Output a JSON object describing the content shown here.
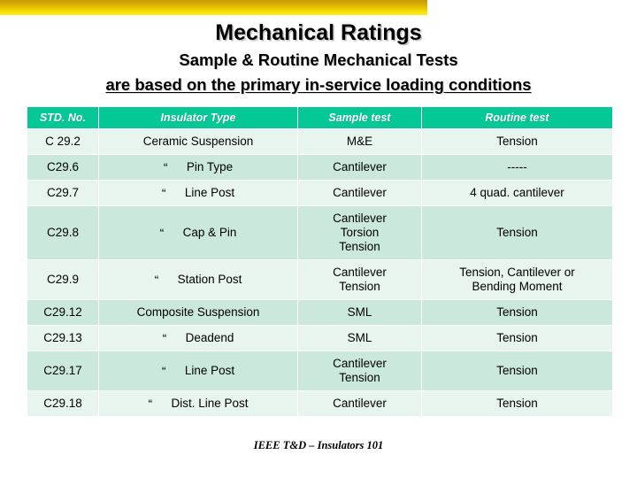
{
  "decor": {
    "gold_bar_color_top": "#c79a06",
    "gold_bar_color_bottom": "#f9ef10"
  },
  "heading": {
    "title": "Mechanical Ratings",
    "subtitle_line1": "Sample & Routine Mechanical Tests",
    "subtitle_line2": "are based on the primary in-service loading conditions"
  },
  "table": {
    "header_bg": "#06c896",
    "row_bg_light": "#e8f4ee",
    "row_bg_dark": "#cbe8dc",
    "columns": [
      "STD. No.",
      "Insulator Type",
      "Sample test",
      "Routine test"
    ],
    "ditto_mark": "“",
    "rows": [
      {
        "std": "C 29.2",
        "ditto": "",
        "type": "Ceramic Suspension",
        "sample": "M&E",
        "routine": "Tension"
      },
      {
        "std": "C29.6",
        "ditto": "“",
        "type": "Pin Type",
        "sample": "Cantilever",
        "routine": "-----"
      },
      {
        "std": "C29.7",
        "ditto": "“",
        "type": "Line Post",
        "sample": "Cantilever",
        "routine": "4 quad. cantilever"
      },
      {
        "std": "C29.8",
        "ditto": "“",
        "type": "Cap & Pin",
        "sample": "Cantilever\nTorsion\nTension",
        "routine": "Tension"
      },
      {
        "std": "C29.9",
        "ditto": "“",
        "type": "Station Post",
        "sample": "Cantilever\nTension",
        "routine": "Tension, Cantilever or\nBending Moment"
      },
      {
        "std": "C29.12",
        "ditto": "",
        "type": "Composite Suspension",
        "sample": "SML",
        "routine": "Tension"
      },
      {
        "std": "C29.13",
        "ditto": "“",
        "type": "Deadend",
        "sample": "SML",
        "routine": "Tension"
      },
      {
        "std": "C29.17",
        "ditto": "“",
        "type": "Line Post",
        "sample": "Cantilever\nTension",
        "routine": "Tension"
      },
      {
        "std": "C29.18",
        "ditto": "“",
        "type": "Dist. Line Post",
        "sample": "Cantilever",
        "routine": "Tension"
      }
    ]
  },
  "footer": {
    "note": "IEEE T&D – Insulators 101"
  }
}
